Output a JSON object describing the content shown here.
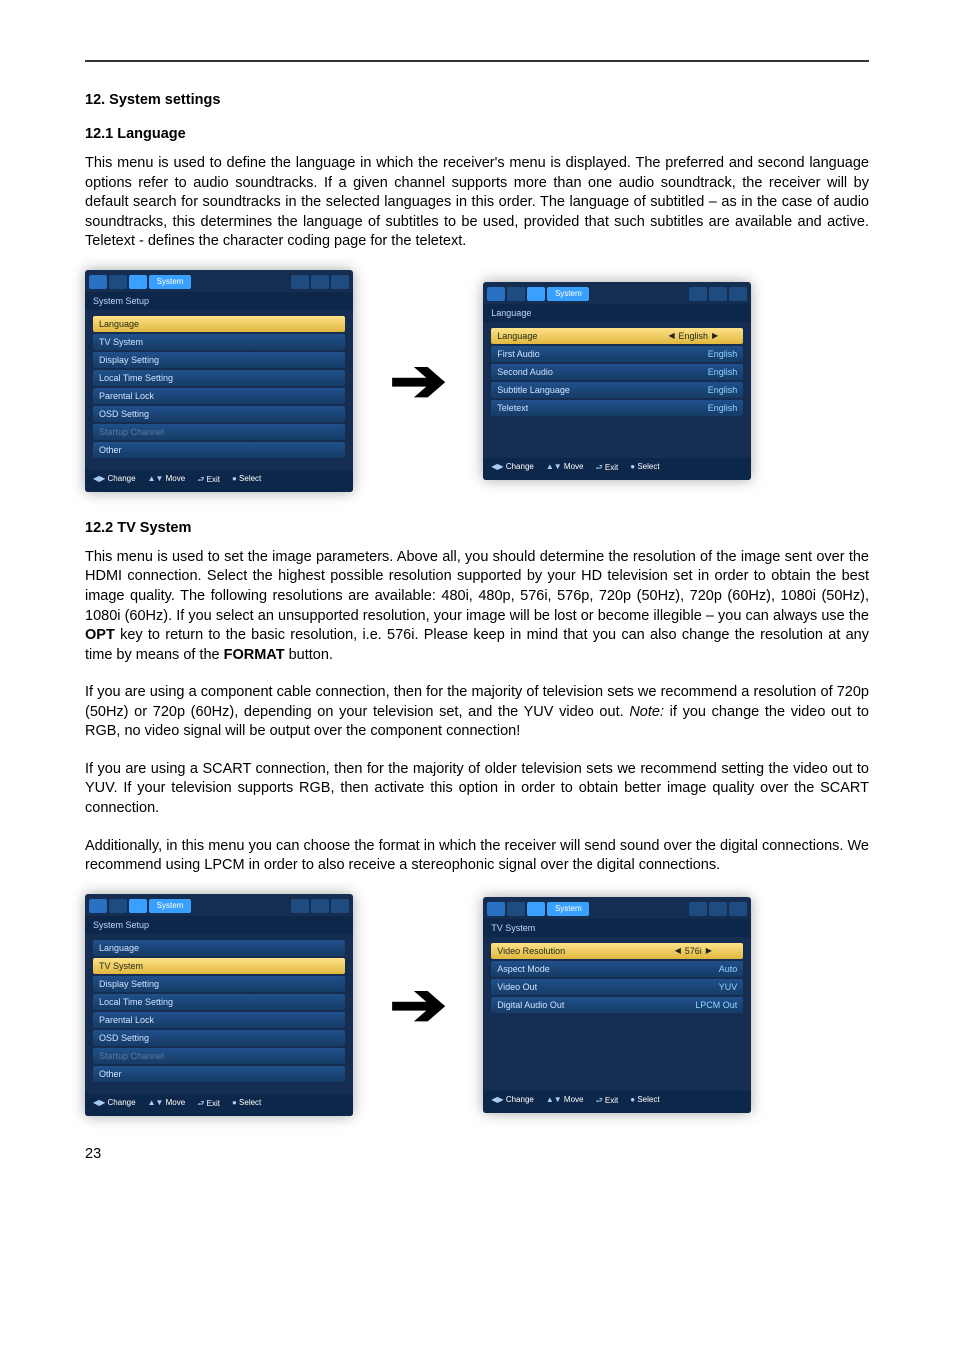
{
  "pageNumber": "23",
  "h_main": "12. System settings",
  "s1": {
    "heading": "12.1 Language",
    "para": "This menu is used to define the language in which the receiver's menu is displayed. The preferred and second language options refer to audio soundtracks. If a given channel supports more than one audio soundtrack, the receiver will by default search for soundtracks in the selected languages in this order. The language of subtitled – as in the case of audio soundtracks, this determines the language of subtitles to be used, provided that such subtitles are available and active. Teletext - defines the character coding page for the teletext.",
    "leftTitle": "System Setup",
    "leftItems": [
      "Language",
      "TV System",
      "Display Setting",
      "Local Time Setting",
      "Parental Lock",
      "OSD Setting",
      "Startup Channel",
      "Other"
    ],
    "leftSelectedIndex": 0,
    "rightTitle": "Language",
    "rightRows": [
      {
        "label": "Language",
        "value": "English",
        "sel": true
      },
      {
        "label": "First Audio",
        "value": "English"
      },
      {
        "label": "Second Audio",
        "value": "English"
      },
      {
        "label": "Subtitle Language",
        "value": "English"
      },
      {
        "label": "Teletext",
        "value": "English"
      }
    ]
  },
  "s2": {
    "heading": "12.2 TV System",
    "p1a": "This menu is used to set the image parameters. Above all, you should determine the resolution of the image sent over the HDMI connection. Select the highest possible resolution supported by your HD television set in order to obtain the best image quality. The following resolutions are available: 480i, 480p, 576i, 576p, 720p (50Hz), 720p (60Hz), 1080i (50Hz), 1080i (60Hz). If you select an unsupported resolution, your image will be lost or become illegible – you can always use the ",
    "p1b": " key to return to the basic resolution, i.e. 576i. Please keep in mind that you can also change the resolution at any time by means of the ",
    "p1c": " button.",
    "opt": "OPT",
    "format": "FORMAT",
    "p2a": "If you are using a component cable connection, then for the majority of television sets we recommend a resolution of 720p (50Hz) or 720p (60Hz), depending on your television set, and the YUV video out. ",
    "p2note": "Note:",
    "p2b": " if you change the video out to RGB, no video signal will be output over the component connection!",
    "p3": "If you are using a SCART connection, then for the majority of older television sets we recommend setting the video out to YUV. If your television supports RGB, then activate this option in order to obtain better image quality over the SCART connection.",
    "p4": "Additionally, in this menu you can choose the format in which the receiver will send sound over the digital connections. We recommend using LPCM in order to also receive a stereophonic signal over the digital connections.",
    "leftTitle": "System Setup",
    "leftItems": [
      "Language",
      "TV System",
      "Display Setting",
      "Local Time Setting",
      "Parental Lock",
      "OSD Setting",
      "Startup Channel",
      "Other"
    ],
    "leftSelectedIndex": 1,
    "rightTitle": "TV System",
    "rightRows": [
      {
        "label": "Video Resolution",
        "value": "576i",
        "sel": true
      },
      {
        "label": "Aspect Mode",
        "value": "Auto"
      },
      {
        "label": "Video Out",
        "value": "YUV"
      },
      {
        "label": "Digital Audio Out",
        "value": "LPCM Out"
      }
    ]
  },
  "tabs": {
    "systemLabel": "System"
  },
  "foot": {
    "change": "Change",
    "move": "Move",
    "exit": "Exit",
    "select": "Select"
  }
}
